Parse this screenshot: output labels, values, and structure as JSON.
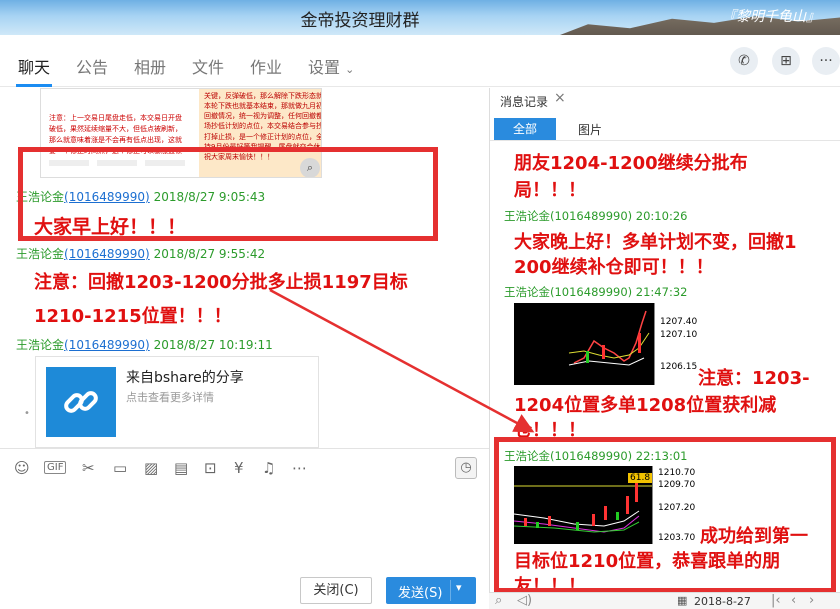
{
  "window": {
    "title": "金帝投资理财群",
    "brand": "『黎明千龟山』"
  },
  "tabs": [
    "聊天",
    "公告",
    "相册",
    "文件",
    "作业",
    "设置"
  ],
  "header_icons": [
    "phone-icon",
    "add-message-icon",
    "more-icon"
  ],
  "left_chat": {
    "image_preview": {
      "left_text": "注意：上一交易日尾盘走低，本交易日开盘破低，果然延续缩量不大，但低点被刷新，那么就意味着涨是不会再有低点出现，这就要一个修正时间点，这个修正可以暴涨盘顿",
      "right_text": "关键，反弹破低，那么解除下跌形态就被破坏，本轮下跌也就基本结束，那就做九月初最会出现回撤情况，统一视为调整，任何回撤都是我们入场抄低计划的点位，本交易结合参与抄空单不幸打掉止损，是一个修正计划的点位，全局计划维持9月份最好等我提醒，尾盘就交合休息了，提前祝大家周末愉快！！！"
    },
    "messages": [
      {
        "sender": "王浩论金",
        "qq": "(1016489990)",
        "time": "2018/8/27 9:05:43",
        "text": "大家早上好！！！"
      },
      {
        "sender": "王浩论金",
        "qq": "(1016489990)",
        "time": "2018/8/27 9:55:42",
        "text_line1": "注意：回撤1203-1200分批多止损1197目标",
        "text_line2": "1210-1215位置！！！"
      },
      {
        "sender": "王浩论金",
        "qq": "(1016489990)",
        "time": "2018/8/27 10:19:11",
        "share_title": "来自bshare的分享",
        "share_sub": "点击查看更多详情"
      }
    ]
  },
  "toolbar_icons": [
    "emoji-icon",
    "gif-icon",
    "scissors-icon",
    "folder-icon",
    "image-icon",
    "photo-booth-icon",
    "gift-icon",
    "red-packet-icon",
    "bell-icon",
    "more-dots-icon"
  ],
  "buttons": {
    "close": "关闭(C)",
    "send": "发送(S)"
  },
  "right_panel": {
    "title": "消息记录",
    "tab_all": "全部",
    "tab_pic": "图片",
    "top_text_line1": "朋友1204-1200继续分批布",
    "top_text_line2": "局！！！",
    "messages": [
      {
        "sender": "王浩论金",
        "qq": "(1016489990)",
        "time": "20:10:26",
        "text_line1": "大家晚上好！多单计划不变，回撤1",
        "text_line2": "200继续补仓即可！！！"
      },
      {
        "sender": "王浩论金",
        "qq": "(1016489990)",
        "time": "21:47:32",
        "chart_ticks": [
          "1207.40",
          "1207.10",
          "1206.15"
        ],
        "text_line1": "注意：1203-",
        "text_line2": "1204位置多单1208位置获利减",
        "text_line3": "仓！！！"
      },
      {
        "sender": "王浩论金",
        "qq": "(1016489990)",
        "time": "22:13:01",
        "chart_ticks": [
          "1210.70",
          "1209.70",
          "1207.20",
          "1203.70"
        ],
        "chart_badge": "61.8",
        "text_line1": "成功给到第一",
        "text_line2": "目标位1210位置，恭喜跟单的朋",
        "text_line3": "友！！！"
      }
    ],
    "date": "2018-8-27"
  }
}
